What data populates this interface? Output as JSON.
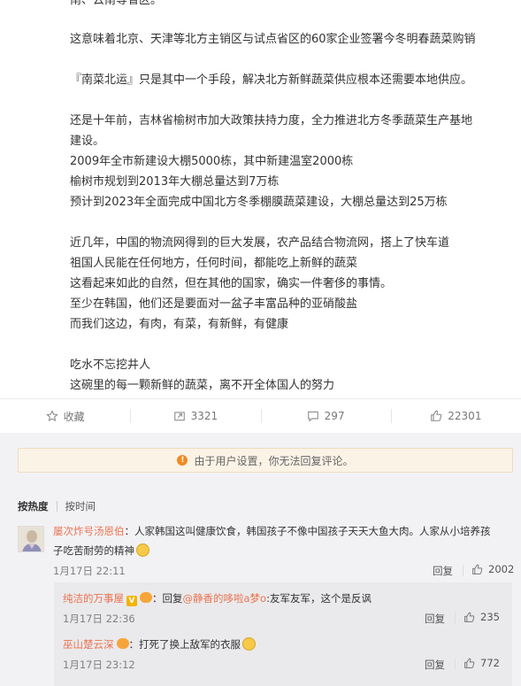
{
  "article": {
    "clipped_top_line": "南、云南等省区。",
    "lines": [
      "这意味着北京、天津等北方主销区与试点省区的60家企业签署今冬明春蔬菜购销",
      "",
      "『南菜北运』只是其中一个手段，解决北方新鲜蔬菜供应根本还需要本地供应。",
      "",
      "还是十年前，吉林省榆树市加大政策扶持力度，全力推进北方冬季蔬菜生产基地",
      "建设。",
      "2009年全市新建设大棚5000栋，其中新建温室2000栋",
      "榆树市规划到2013年大棚总量达到7万栋",
      "预计到2023年全面完成中国北方冬季棚膜蔬菜建设，大棚总量达到25万栋",
      "",
      "近几年，中国的物流网得到的巨大发展，农产品结合物流网，搭上了快车道",
      "祖国人民能在任何地方，任何时间，都能吃上新鲜的蔬菜",
      "这看起来如此的自然，但在其他的国家，确实一件奢侈的事情。",
      "至少在韩国，他们还是要面对一盆子丰富品种的亚硝酸盐",
      "而我们这边，有肉，有菜，有新鲜，有健康",
      "",
      "吃水不忘挖井人",
      "这碗里的每一颗新鲜的蔬菜，离不开全体国人的努力"
    ]
  },
  "actions": {
    "favorite": "收藏",
    "repost": "3321",
    "comment": "297",
    "like": "22301"
  },
  "notice": "由于用户设置，你无法回复评论。",
  "sort": {
    "hot": "按热度",
    "time": "按时间"
  },
  "comments": [
    {
      "user": "屡次炸号汤恩伯",
      "text_line1": "：人家韩国这叫健康饮食，韩国孩子不像中国孩子天天大鱼大肉。人家从小培养孩",
      "text_line2": "子吃苦耐劳的精神",
      "time": "1月17日 22:11",
      "reply": "回复",
      "likes": "2002"
    }
  ],
  "subcomments": [
    {
      "user": "纯洁的万事屋",
      "reply_prefix": "：回复",
      "mention": "@静香的哆啦a梦o",
      "text": ":友军友军，这个是反讽",
      "time": "1月17日 22:36",
      "reply": "回复",
      "likes": "235"
    },
    {
      "user": "巫山楚云深",
      "text": "：打死了换上敌军的衣服",
      "time": "1月17日 23:12",
      "reply": "回复",
      "likes": "772"
    }
  ],
  "colors": {
    "username": "#eb7350",
    "notice_bg": "#fbf3e6",
    "warn_icon": "#f08a24"
  }
}
